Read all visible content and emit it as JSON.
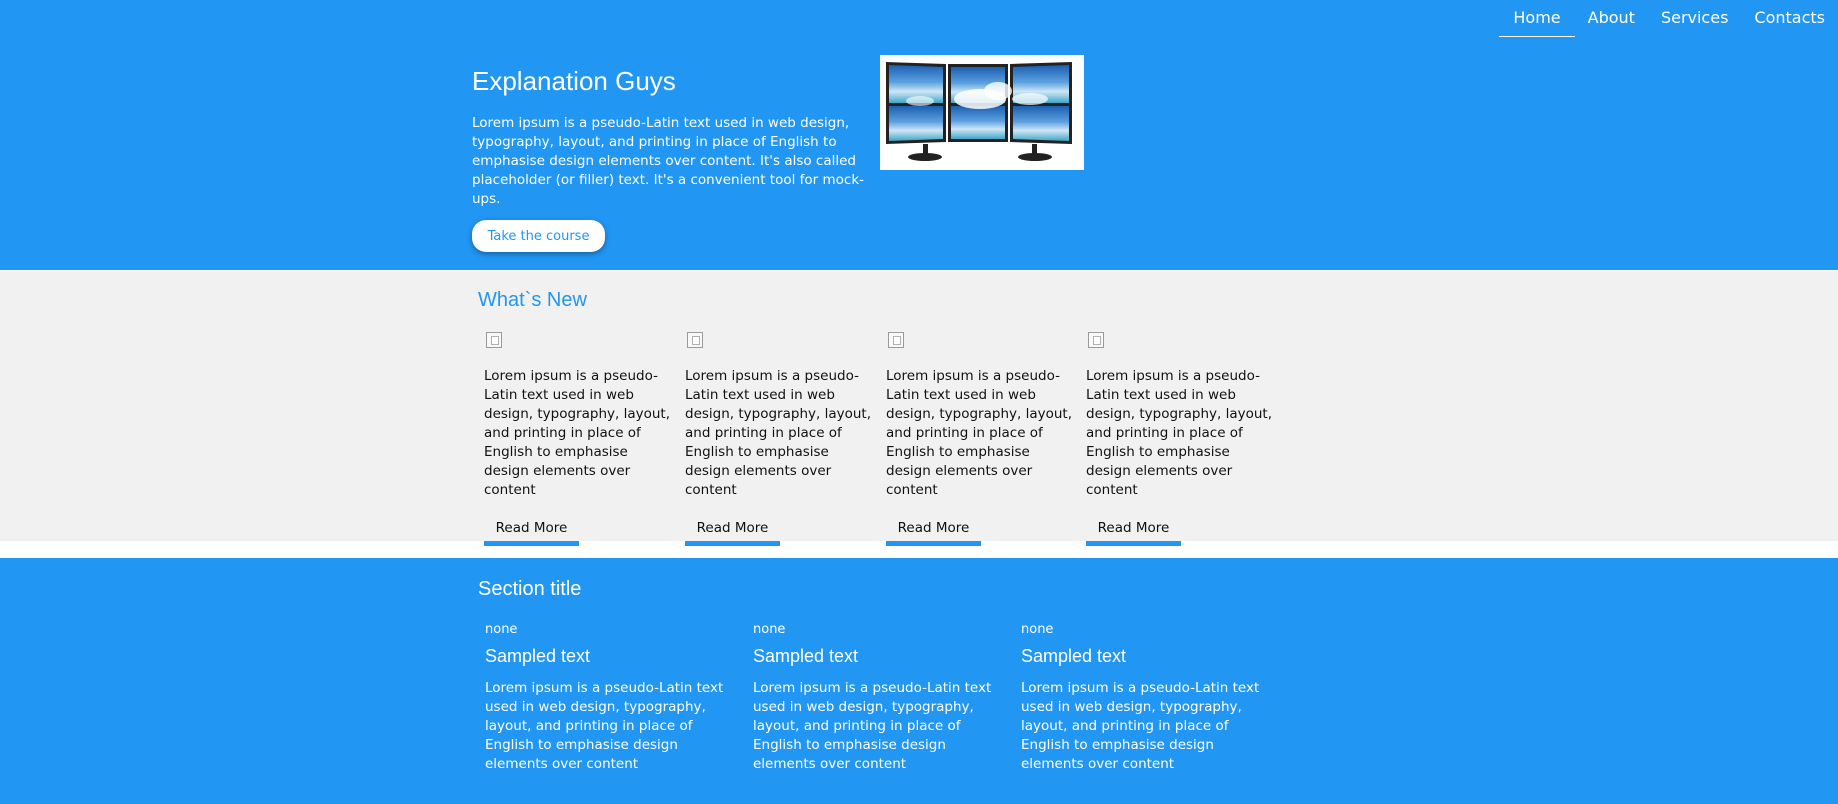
{
  "nav": {
    "items": [
      {
        "label": "Home",
        "active": true
      },
      {
        "label": "About",
        "active": false
      },
      {
        "label": "Services",
        "active": false
      },
      {
        "label": "Contacts",
        "active": false
      }
    ]
  },
  "hero": {
    "title": "Explanation Guys",
    "text": "Lorem ipsum is a pseudo-Latin text used in web design, typography, layout, and printing in place of English to emphasise design elements over content. It's also called placeholder (or filler) text. It's a convenient tool for mock-ups.",
    "button_label": "Take the course",
    "image_icon": "monitor-wall-image"
  },
  "news": {
    "title": "What`s New",
    "cards": [
      {
        "icon": "broken-image-icon",
        "text": "Lorem ipsum is a pseudo-Latin text used in web design, typography, layout, and printing in place of English to emphasise design elements over content",
        "button_label": "Read More"
      },
      {
        "icon": "broken-image-icon",
        "text": "Lorem ipsum is a pseudo-Latin text used in web design, typography, layout, and printing in place of English to emphasise design elements over content",
        "button_label": "Read More"
      },
      {
        "icon": "broken-image-icon",
        "text": "Lorem ipsum is a pseudo-Latin text used in web design, typography, layout, and printing in place of English to emphasise design elements over content",
        "button_label": "Read More"
      },
      {
        "icon": "broken-image-icon",
        "text": "Lorem ipsum is a pseudo-Latin text used in web design, typography, layout, and printing in place of English to emphasise design elements over content",
        "button_label": "Read More"
      }
    ]
  },
  "section": {
    "title": "Section title",
    "columns": [
      {
        "meta": "none",
        "title": "Sampled text",
        "text": "Lorem ipsum is a pseudo-Latin text used in web design, typography, layout, and printing in place of English to emphasise design elements over content"
      },
      {
        "meta": "none",
        "title": "Sampled text",
        "text": "Lorem ipsum is a pseudo-Latin text used in web design, typography, layout, and printing in place of English to emphasise design elements over content"
      },
      {
        "meta": "none",
        "title": "Sampled text",
        "text": "Lorem ipsum is a pseudo-Latin text used in web design, typography, layout, and printing in place of English to emphasise design elements over content"
      }
    ]
  },
  "colors": {
    "primary": "#2196f3",
    "light_bg": "#f1f1f1",
    "white": "#ffffff"
  }
}
